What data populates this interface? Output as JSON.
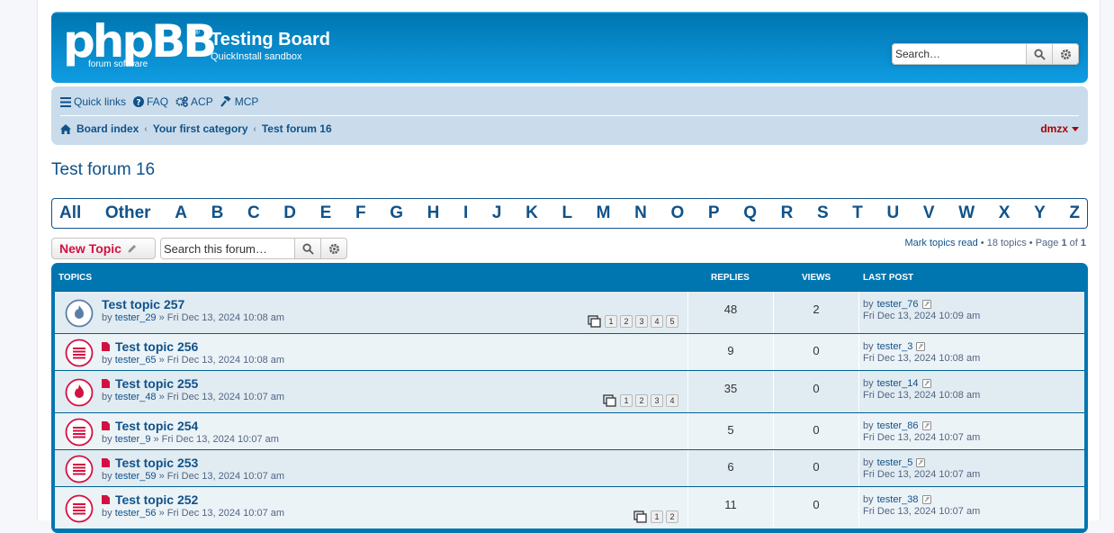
{
  "header": {
    "logo_main": "phpBB",
    "logo_sub": "forum software",
    "logo_reg": "®",
    "site_title": "Testing Board",
    "site_desc": "QuickInstall sandbox",
    "search_placeholder": "Search…"
  },
  "nav": {
    "quick_links": "Quick links",
    "faq": "FAQ",
    "acp": "ACP",
    "mcp": "MCP",
    "breadcrumbs": [
      "Board index",
      "Your first category",
      "Test forum 16"
    ],
    "username": "dmzx"
  },
  "forum_title": "Test forum 16",
  "alphabet": [
    "All",
    "Other",
    "A",
    "B",
    "C",
    "D",
    "E",
    "F",
    "G",
    "H",
    "I",
    "J",
    "K",
    "L",
    "M",
    "N",
    "O",
    "P",
    "Q",
    "R",
    "S",
    "T",
    "U",
    "V",
    "W",
    "X",
    "Y",
    "Z"
  ],
  "actions": {
    "new_topic": "New Topic",
    "search_placeholder": "Search this forum…"
  },
  "pagination": {
    "mark_read": "Mark topics read",
    "topics_count": " • 18 topics • Page ",
    "page": "1",
    "of": " of ",
    "total": "1"
  },
  "table": {
    "headers": {
      "topics": "TOPICS",
      "replies": "REPLIES",
      "views": "VIEWS",
      "last_post": "LAST POST"
    },
    "rows": [
      {
        "title": "Test topic 257",
        "author": "tester_29",
        "date": "» Fri Dec 13, 2024 10:08 am",
        "replies": "48",
        "views": "2",
        "last_by": "tester_76",
        "last_date": "Fri Dec 13, 2024 10:09 am",
        "pages": [
          "1",
          "2",
          "3",
          "4",
          "5"
        ],
        "hot": true,
        "unread": true
      },
      {
        "title": "Test topic 256",
        "author": "tester_65",
        "date": "» Fri Dec 13, 2024 10:08 am",
        "replies": "9",
        "views": "0",
        "last_by": "tester_3",
        "last_date": "Fri Dec 13, 2024 10:08 am",
        "pages": [],
        "hot": false,
        "unread": true
      },
      {
        "title": "Test topic 255",
        "author": "tester_48",
        "date": "» Fri Dec 13, 2024 10:07 am",
        "replies": "35",
        "views": "0",
        "last_by": "tester_14",
        "last_date": "Fri Dec 13, 2024 10:08 am",
        "pages": [
          "1",
          "2",
          "3",
          "4"
        ],
        "hot": true,
        "unread": true
      },
      {
        "title": "Test topic 254",
        "author": "tester_9",
        "date": "» Fri Dec 13, 2024 10:07 am",
        "replies": "5",
        "views": "0",
        "last_by": "tester_86",
        "last_date": "Fri Dec 13, 2024 10:07 am",
        "pages": [],
        "hot": false,
        "unread": true
      },
      {
        "title": "Test topic 253",
        "author": "tester_59",
        "date": "» Fri Dec 13, 2024 10:07 am",
        "replies": "6",
        "views": "0",
        "last_by": "tester_5",
        "last_date": "Fri Dec 13, 2024 10:07 am",
        "pages": [],
        "hot": false,
        "unread": true
      },
      {
        "title": "Test topic 252",
        "author": "tester_56",
        "date": "» Fri Dec 13, 2024 10:07 am",
        "replies": "11",
        "views": "0",
        "last_by": "tester_38",
        "last_date": "Fri Dec 13, 2024 10:07 am",
        "pages": [
          "1",
          "2"
        ],
        "hot": false,
        "unread": true
      }
    ],
    "by_label": "by"
  },
  "colors": {
    "brand": "#105289",
    "header_bg": "#12a3eb",
    "new_topic": "#d31141",
    "unread_icon": "#d31141"
  }
}
